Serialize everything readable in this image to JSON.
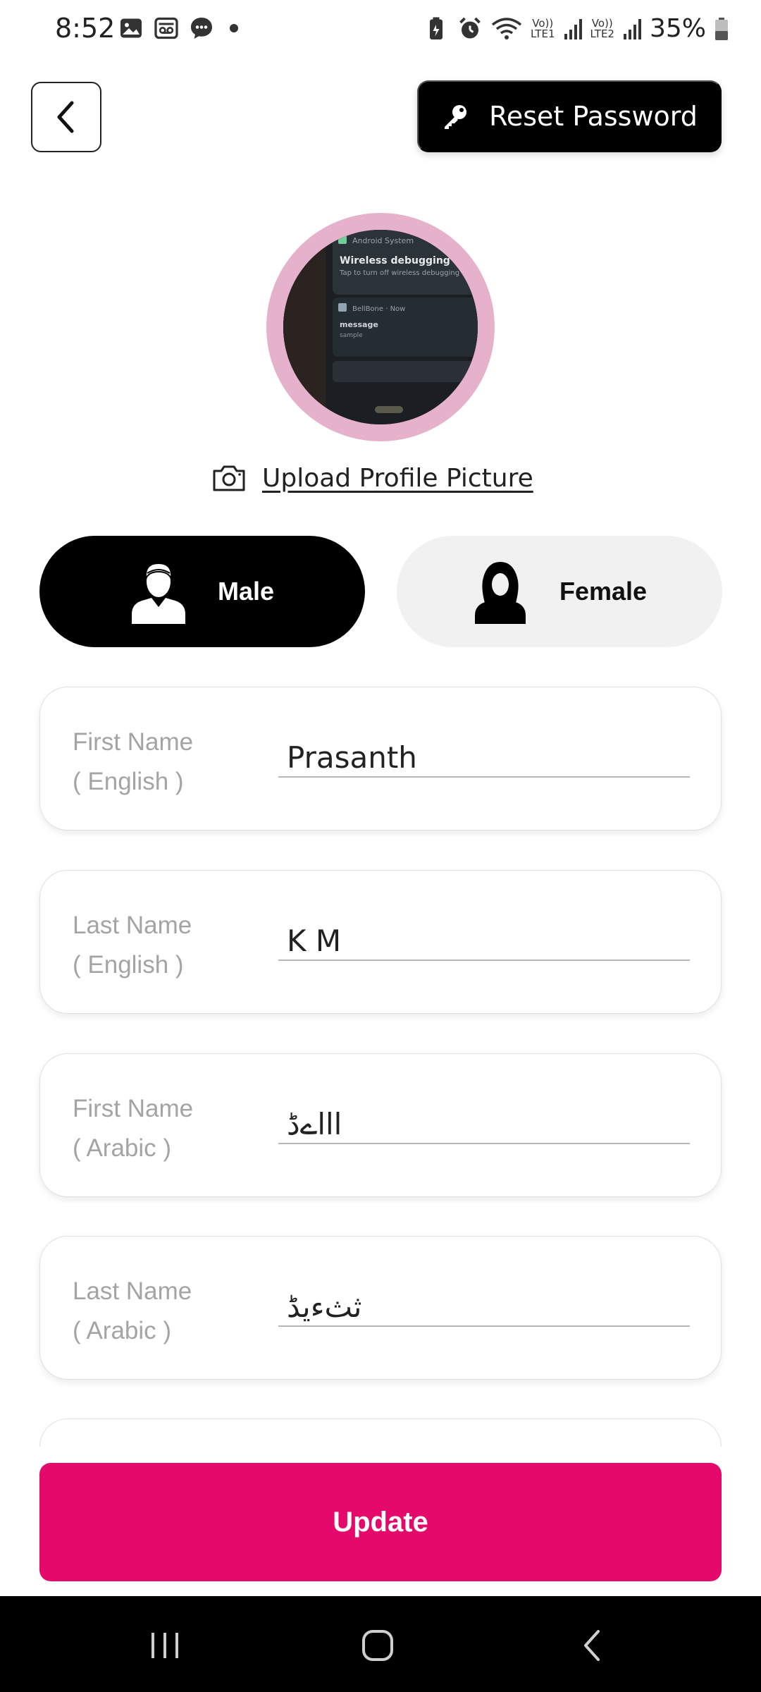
{
  "status_bar": {
    "time": "8:52",
    "battery_percent": "35%",
    "lte1": "LTE1",
    "lte2": "LTE2",
    "vol": "Vo))",
    "icons": [
      "gallery-icon",
      "voicemail-icon",
      "message-icon",
      "notification-dot",
      "battery-saver-icon",
      "alarm-icon",
      "wifi-icon",
      "signal-icon",
      "signal-icon",
      "battery-icon"
    ]
  },
  "header": {
    "back_icon": "chevron-left-icon",
    "reset_label": "Reset Password",
    "reset_icon": "key-icon"
  },
  "profile": {
    "upload_label": "Upload Profile Picture",
    "upload_icon": "camera-icon",
    "ring_color": "#e6b1cb",
    "photo_texts": {
      "app": "Android System",
      "title": "Wireless debugging connected",
      "subtitle": "Tap to turn off wireless debugging",
      "app2": "BellBone · Now",
      "msg_title": "message",
      "msg_sub": "sample"
    }
  },
  "gender": {
    "male_label": "Male",
    "female_label": "Female",
    "selected": "Male",
    "male_icon": "male-avatar-icon",
    "female_icon": "female-hijab-icon"
  },
  "form": {
    "fields": [
      {
        "label": "First Name\n( English )",
        "value": "Prasanth"
      },
      {
        "label": "Last Name\n( English )",
        "value": "K M"
      },
      {
        "label": "First Name\n( Arabic )",
        "value": "اااےڈ"
      },
      {
        "label": "Last Name\n( Arabic )",
        "value": "ثثءیڈ"
      }
    ]
  },
  "actions": {
    "update_label": "Update"
  },
  "colors": {
    "accent": "#e5096b",
    "primary": "#000000",
    "label_gray": "#a4a4a4"
  },
  "nav": {
    "recents_icon": "recents-icon",
    "home_icon": "home-icon",
    "back_icon": "nav-back-icon"
  }
}
